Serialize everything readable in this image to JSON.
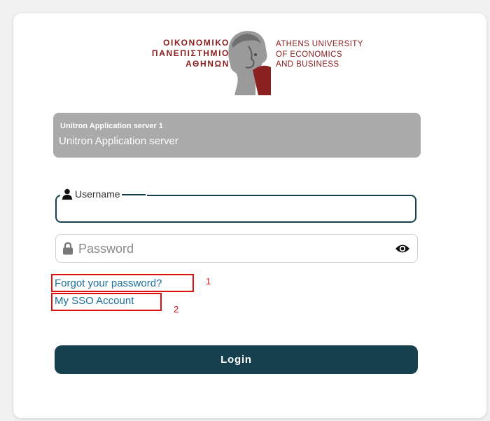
{
  "logo": {
    "greek": [
      "ΟΙΚΟΝΟΜΙΚΟ",
      "ΠΑΝΕΠΙΣΤΗΜΙΟ",
      "ΑΘΗΝΩΝ"
    ],
    "english": [
      "ATHENS UNIVERSITY",
      "OF ECONOMICS",
      "AND BUSINESS"
    ]
  },
  "server": {
    "title": "Unitron Application server 1",
    "subtitle": "Unitron Application server"
  },
  "form": {
    "username_label": "Username",
    "username_value": "",
    "password_placeholder": "Password",
    "password_value": ""
  },
  "links": {
    "forgot": "Forgot your password?",
    "sso": "My SSO Account"
  },
  "annotations": [
    "1",
    "2"
  ],
  "login_label": "Login",
  "colors": {
    "brand": "#8a2020",
    "primary": "#17404f",
    "link": "#1c6f9a",
    "annotation": "#e01010"
  }
}
